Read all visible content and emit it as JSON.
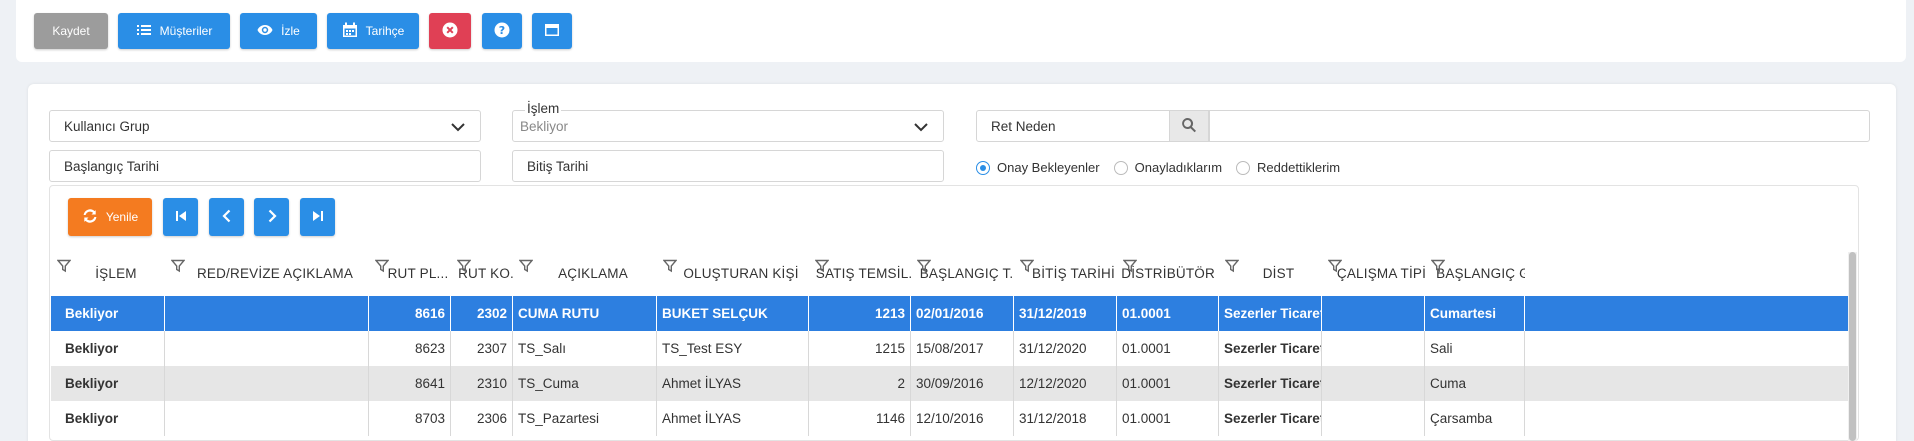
{
  "toolbar": {
    "save_label": "Kaydet",
    "customers_label": "Müşteriler",
    "watch_label": "İzle",
    "history_label": "Tarihçe"
  },
  "filters": {
    "user_group_label": "Kullanıcı Grup",
    "start_date_label": "Başlangıç Tarihi",
    "operation_label": "İşlem",
    "operation_value": "Bekliyor",
    "end_date_label": "Bitiş Tarihi",
    "reject_reason_label": "Ret Neden",
    "radios": [
      {
        "label": "Onay Bekleyenler",
        "checked": true
      },
      {
        "label": "Onayladıklarım",
        "checked": false
      },
      {
        "label": "Reddettiklerim",
        "checked": false
      }
    ]
  },
  "grid": {
    "refresh_label": "Yenile",
    "columns": [
      "İŞLEM",
      "RED/REVİZE AÇIKLAMA",
      "RUT PL...",
      "RUT KO...",
      "AÇIKLAMA",
      "OLUŞTURAN KİŞİ",
      "SATIŞ TEMSİL...",
      "BAŞLANGIÇ T...",
      "BİTİŞ TARİHİ",
      "DİSTRİBÜTÖR ...",
      "DİST",
      "ÇALIŞMA TİPİ",
      "BAŞLANGIÇ G"
    ],
    "rows": [
      [
        "Bekliyor",
        "",
        "8616",
        "2302",
        "CUMA RUTU",
        "BUKET SELÇUK",
        "1213",
        "02/01/2016",
        "31/12/2019",
        "01.0001",
        "Sezerler Ticaret",
        "",
        "Cumartesi"
      ],
      [
        "Bekliyor",
        "",
        "8623",
        "2307",
        "TS_Salı",
        "TS_Test ESY",
        "1215",
        "15/08/2017",
        "31/12/2020",
        "01.0001",
        "Sezerler Ticaret",
        "",
        "Sali"
      ],
      [
        "Bekliyor",
        "",
        "8641",
        "2310",
        "TS_Cuma",
        "Ahmet İLYAS",
        "2",
        "30/09/2016",
        "12/12/2020",
        "01.0001",
        "Sezerler Ticaret",
        "",
        "Cuma"
      ],
      [
        "Bekliyor",
        "",
        "8703",
        "2306",
        "TS_Pazartesi",
        "Ahmet İLYAS",
        "1146",
        "12/10/2016",
        "31/12/2018",
        "01.0001",
        "Sezerler Ticaret",
        "",
        "Çarsamba"
      ]
    ]
  },
  "colors": {
    "primary": "#2a8ee6",
    "danger": "#e04055",
    "warning": "#f47b20",
    "selected_row": "#2d7fe0"
  }
}
